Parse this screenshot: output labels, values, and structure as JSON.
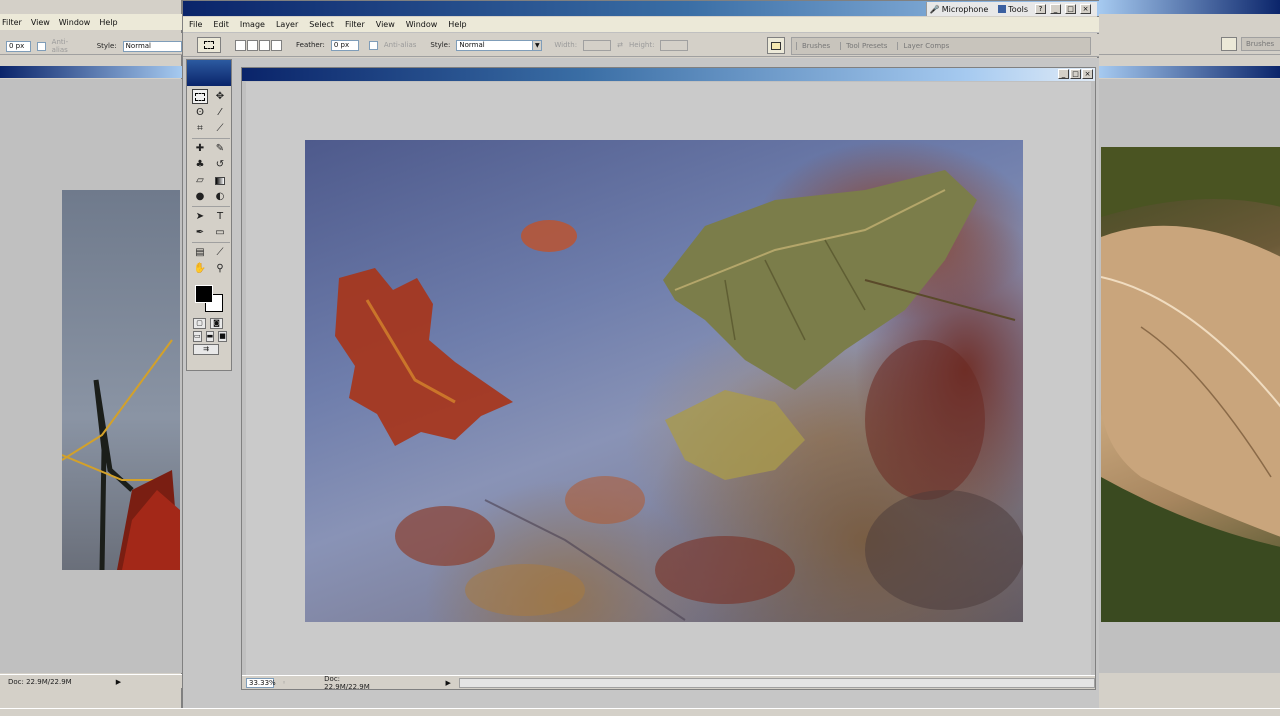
{
  "left_window": {
    "menu": [
      "Filter",
      "View",
      "Window",
      "Help"
    ],
    "feather_value": "0 px",
    "anti_alias_label": "Anti-alias",
    "style_label": "Style:",
    "style_value": "Normal",
    "status_doc": "Doc: 22.9M/22.9M"
  },
  "main_window": {
    "langbar": {
      "microphone_label": "Microphone",
      "tools_label": "Tools"
    },
    "menu": [
      "File",
      "Edit",
      "Image",
      "Layer",
      "Select",
      "Filter",
      "View",
      "Window",
      "Help"
    ],
    "options": {
      "feather_label": "Feather:",
      "feather_value": "0 px",
      "anti_alias_label": "Anti-alias",
      "style_label": "Style:",
      "style_value": "Normal",
      "width_label": "Width:",
      "height_label": "Height:"
    },
    "palette_well_tabs": [
      "Brushes",
      "Tool Presets",
      "Layer Comps"
    ],
    "document": {
      "zoom": "33.33%",
      "status_doc": "Doc: 22.9M/22.9M"
    }
  },
  "right_window": {
    "palette_well_tabs": [
      "Brushes"
    ]
  },
  "colors": {
    "title_active": "#0a246a",
    "title_gradient_end": "#a6caf0",
    "chrome": "#d4d0c8",
    "foreground_color": "#000000",
    "background_color": "#ffffff"
  },
  "toolbox": {
    "icons": [
      "marquee-icon",
      "move-icon",
      "lasso-icon",
      "magic-wand-icon",
      "crop-icon",
      "slice-icon",
      "healing-brush-icon",
      "brush-icon",
      "clone-stamp-icon",
      "history-brush-icon",
      "eraser-icon",
      "gradient-icon",
      "blur-icon",
      "dodge-icon",
      "path-selection-icon",
      "type-icon",
      "pen-icon",
      "shape-icon",
      "notes-icon",
      "eyedropper-icon",
      "hand-icon",
      "zoom-icon"
    ]
  }
}
